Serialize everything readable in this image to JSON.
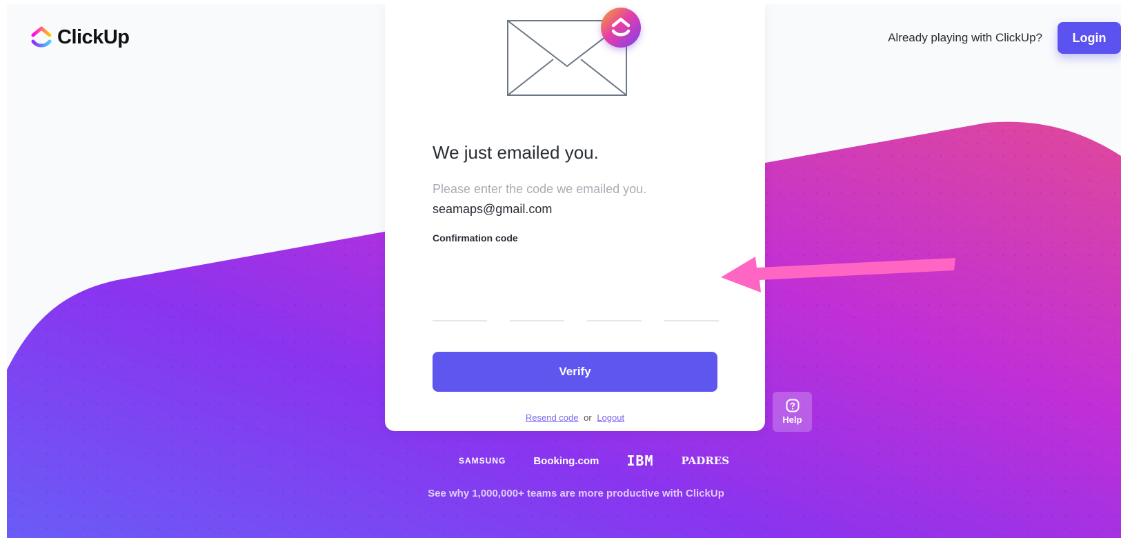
{
  "brand": {
    "name": "ClickUp"
  },
  "header": {
    "already_text": "Already playing with ClickUp?",
    "login_label": "Login"
  },
  "card": {
    "title": "We just emailed you.",
    "subtitle": "Please enter the code we emailed you.",
    "email": "seamaps@gmail.com",
    "code_label": "Confirmation code",
    "code_digits": [
      "",
      "",
      "",
      ""
    ],
    "verify_label": "Verify",
    "resend_label": "Resend code",
    "or_text": "or",
    "logout_label": "Logout"
  },
  "help": {
    "label": "Help"
  },
  "brands": [
    "SAMSUNG",
    "Booking.com",
    "IBM",
    "PADRES"
  ],
  "tagline": "See why 1,000,000+ teams are more productive with ClickUp",
  "colors": {
    "accent": "#5b52ef",
    "gradient_start": "#6a47f5",
    "gradient_end": "#e64ba0",
    "arrow": "#ff66c4"
  },
  "icons": {
    "logo": "clickup-logo-icon",
    "envelope": "envelope-icon",
    "help": "question-circle-icon",
    "arrow": "annotation-arrow-icon"
  }
}
